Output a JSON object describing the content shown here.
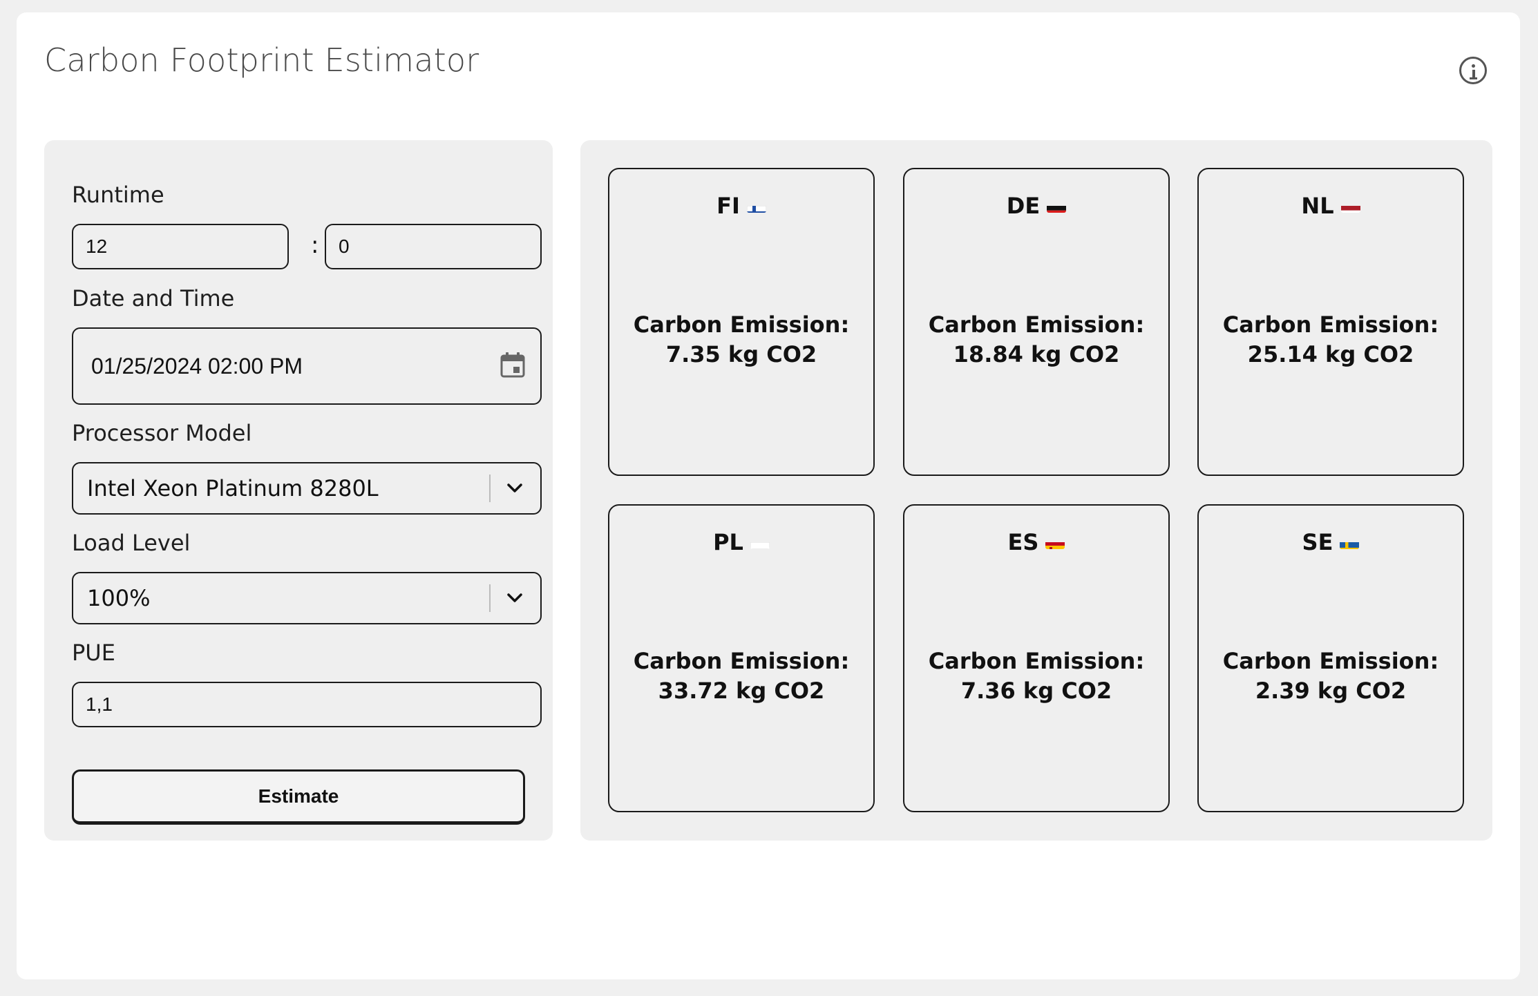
{
  "app": {
    "title": "Carbon Footprint Estimator"
  },
  "form": {
    "runtime_label": "Runtime",
    "runtime_hours": "12",
    "runtime_separator": ":",
    "runtime_minutes": "0",
    "datetime_label": "Date and Time",
    "datetime_value": "01/25/2024 02:00 PM",
    "processor_label": "Processor Model",
    "processor_value": "Intel Xeon Platinum 8280L",
    "load_label": "Load Level",
    "load_value": "100%",
    "pue_label": "PUE",
    "pue_value": "1,1",
    "estimate_label": "Estimate"
  },
  "results": [
    {
      "code": "FI",
      "flag": "finland",
      "label": "Carbon Emission:",
      "value": "7.35 kg CO2"
    },
    {
      "code": "DE",
      "flag": "germany",
      "label": "Carbon Emission:",
      "value": "18.84 kg CO2"
    },
    {
      "code": "NL",
      "flag": "netherlands",
      "label": "Carbon Emission:",
      "value": "25.14 kg CO2"
    },
    {
      "code": "PL",
      "flag": "poland",
      "label": "Carbon Emission:",
      "value": "33.72 kg CO2"
    },
    {
      "code": "ES",
      "flag": "spain",
      "label": "Carbon Emission:",
      "value": "7.36 kg CO2"
    },
    {
      "code": "SE",
      "flag": "sweden",
      "label": "Carbon Emission:",
      "value": "2.39 kg CO2"
    }
  ],
  "icons": {
    "info": "info-icon",
    "calendar": "calendar-icon",
    "dropdown": "chevron-down-icon"
  }
}
